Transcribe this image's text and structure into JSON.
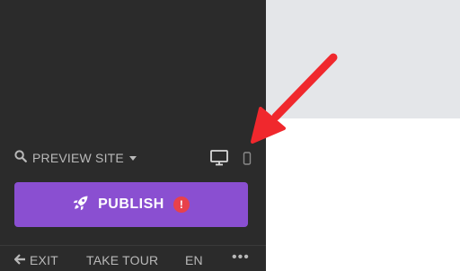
{
  "preview": {
    "label": "PREVIEW SITE",
    "icon": "search-icon",
    "dropdown_icon": "caret-down-icon",
    "devices": [
      "desktop-icon",
      "mobile-icon"
    ]
  },
  "publish": {
    "label": "PUBLISH",
    "icon": "rocket-icon",
    "alert": "!"
  },
  "footer": {
    "exit_label": "EXIT",
    "tour_label": "TAKE TOUR",
    "lang_label": "EN",
    "more_label": "•••"
  },
  "colors": {
    "sidebar": "#2b2b2b",
    "publish": "#8a4fd1",
    "alert": "#e8414b",
    "arrow": "#f0282d",
    "canvas_top": "#e4e6e9"
  }
}
